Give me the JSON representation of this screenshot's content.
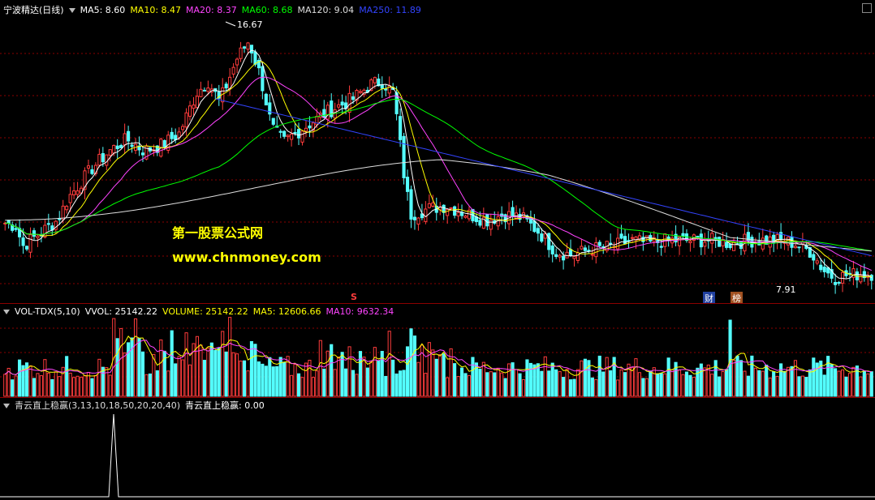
{
  "main_pane": {
    "title": "宁波精达(日线)",
    "ma_labels": [
      {
        "text": "MA5: 8.60",
        "color": "#ffffff"
      },
      {
        "text": "MA10: 8.47",
        "color": "#ffff00"
      },
      {
        "text": "MA20: 8.37",
        "color": "#ff44ff"
      },
      {
        "text": "MA60: 8.68",
        "color": "#00ff00"
      },
      {
        "text": "MA120: 9.04",
        "color": "#dddddd"
      },
      {
        "text": "MA250: 11.89",
        "color": "#3344ff"
      }
    ],
    "high_label": "16.67",
    "low_label": "7.91",
    "marker_s": "S",
    "tag_cai": "财",
    "tag_bang": "榜",
    "watermark_title": "第一股票公式网",
    "watermark_url": "www.chnmoney.com"
  },
  "vol_pane": {
    "title": "VOL-TDX(5,10)",
    "labels": [
      {
        "text": "VVOL: 25142.22",
        "color": "#ffffff"
      },
      {
        "text": "VOLUME: 25142.22",
        "color": "#ffff00"
      },
      {
        "text": "MA5: 12606.66",
        "color": "#ffff00"
      },
      {
        "text": "MA10: 9632.34",
        "color": "#ff44ff"
      }
    ]
  },
  "ind_pane": {
    "title": "青云直上稳赢(3,13,10,18,50,20,20,40)",
    "label": "青云直上稳赢: 0.00"
  },
  "colors": {
    "up": "#ff3c3c",
    "down": "#54ffff",
    "grid": "#8b0000",
    "ma5": "#ffffff",
    "ma10": "#ffff00",
    "ma20": "#ff44ff",
    "ma60": "#00ff00",
    "ma120": "#dddddd",
    "ma250": "#3344ff"
  }
}
